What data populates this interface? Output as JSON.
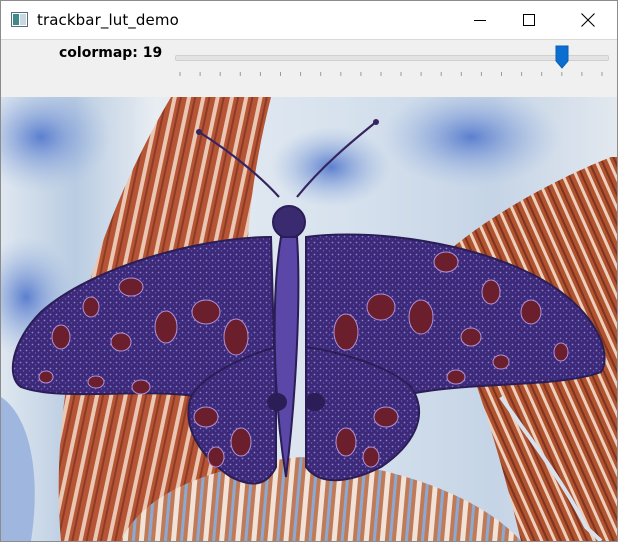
{
  "window": {
    "title": "trackbar_lut_demo"
  },
  "titlebar": {
    "minimize_icon": "minimize-icon",
    "maximize_icon": "maximize-icon",
    "close_icon": "close-icon"
  },
  "trackbar": {
    "label": "colormap: 19",
    "name": "colormap",
    "value": 19,
    "min": 0,
    "max": 21
  },
  "image": {
    "subject": "butterfly",
    "colors": {
      "background_warm": "#b85a3a",
      "background_cool": "#7fa7d4",
      "background_light": "#e9eef3",
      "wing_dark": "#3a2670",
      "wing_spots": "#6b1f2c",
      "wing_mid": "#5a45a8"
    }
  }
}
